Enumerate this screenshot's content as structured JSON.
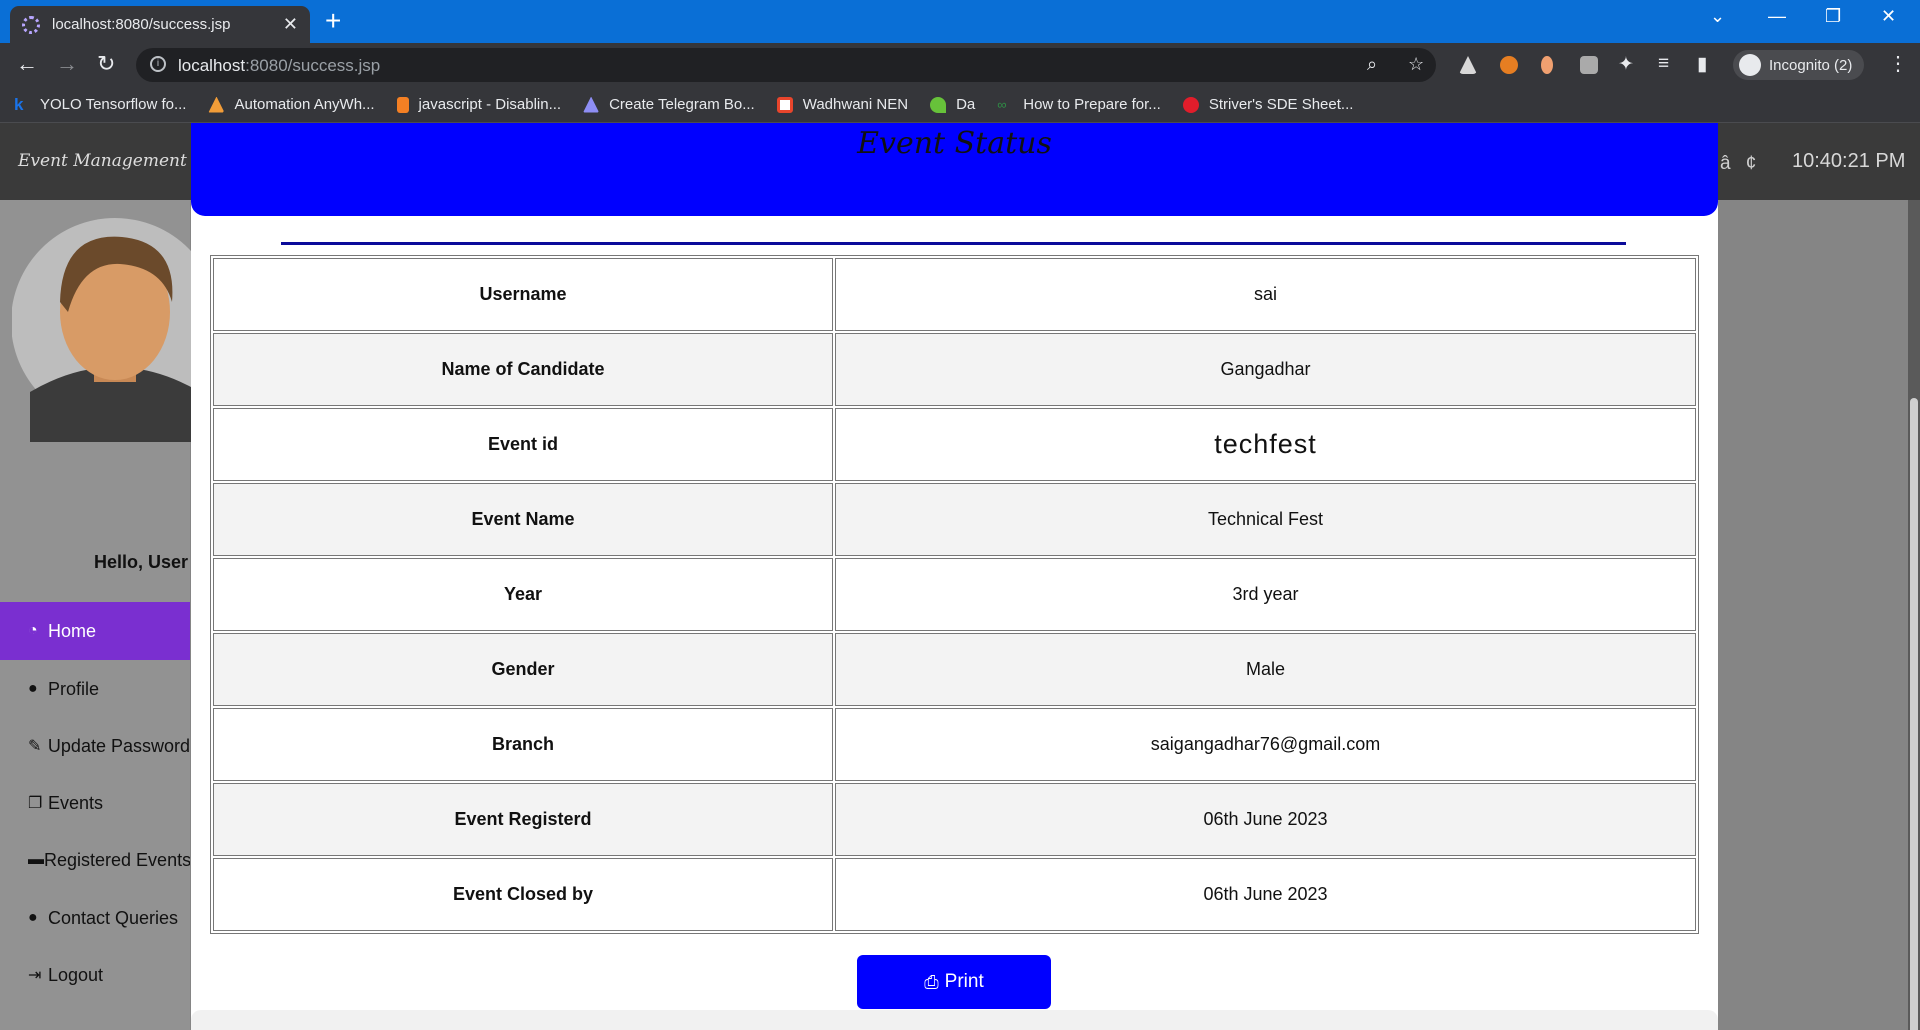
{
  "browser": {
    "tab_title": "localhost:8080/success.jsp",
    "new_tab": "+",
    "url_host": "localhost",
    "url_path": ":8080/success.jsp",
    "profile": "Incognito (2)",
    "bookmarks": [
      {
        "label": "YOLO Tensorflow fo...",
        "icon": "k",
        "color": "#1a73e8"
      },
      {
        "label": "Automation AnyWh...",
        "icon": "triangle",
        "color": "#f29d38"
      },
      {
        "label": "javascript - Disablin...",
        "icon": "stack",
        "color": "#f48024"
      },
      {
        "label": "Create Telegram Bo...",
        "icon": "shapes",
        "color": "#8e8ef5"
      },
      {
        "label": "Wadhwani NEN",
        "icon": "box",
        "color": "#e8452c"
      },
      {
        "label": "Da",
        "icon": "leaf",
        "color": "#67c23a"
      },
      {
        "label": "How to Prepare for...",
        "icon": "gfg",
        "color": "#2f8d46"
      },
      {
        "label": "Striver's SDE Sheet...",
        "icon": "tuf",
        "color": "#e11d2b"
      }
    ]
  },
  "app": {
    "brand": "Event Management Syste",
    "header_glyph": "â¢",
    "clock": "10:40:21 PM"
  },
  "sidebar": {
    "greeting": "Hello, User",
    "items": [
      {
        "label": "Home",
        "icon": "dashboard-icon",
        "active": true
      },
      {
        "label": "Profile",
        "icon": "user-icon"
      },
      {
        "label": "Update Password",
        "icon": "edit-icon"
      },
      {
        "label": "Events",
        "icon": "copy-icon"
      },
      {
        "label": "Registered Events",
        "icon": "card-icon"
      },
      {
        "label": "Contact Queries",
        "icon": "comments-icon"
      },
      {
        "label": "Logout",
        "icon": "sign-out-icon"
      }
    ]
  },
  "modal": {
    "title": "Event Status",
    "rows": [
      {
        "label": "Username",
        "value": "sai"
      },
      {
        "label": "Name of Candidate",
        "value": "Gangadhar"
      },
      {
        "label": "Event id",
        "value": "techfest"
      },
      {
        "label": "Event Name",
        "value": "Technical Fest"
      },
      {
        "label": "Year",
        "value": "3rd year"
      },
      {
        "label": "Gender",
        "value": "Male"
      },
      {
        "label": "Branch",
        "value": "saigangadhar76@gmail.com"
      },
      {
        "label": "Event Registerd",
        "value": "06th June 2023"
      },
      {
        "label": "Event Closed by",
        "value": "06th June 2023"
      }
    ],
    "print_label": "Print"
  }
}
